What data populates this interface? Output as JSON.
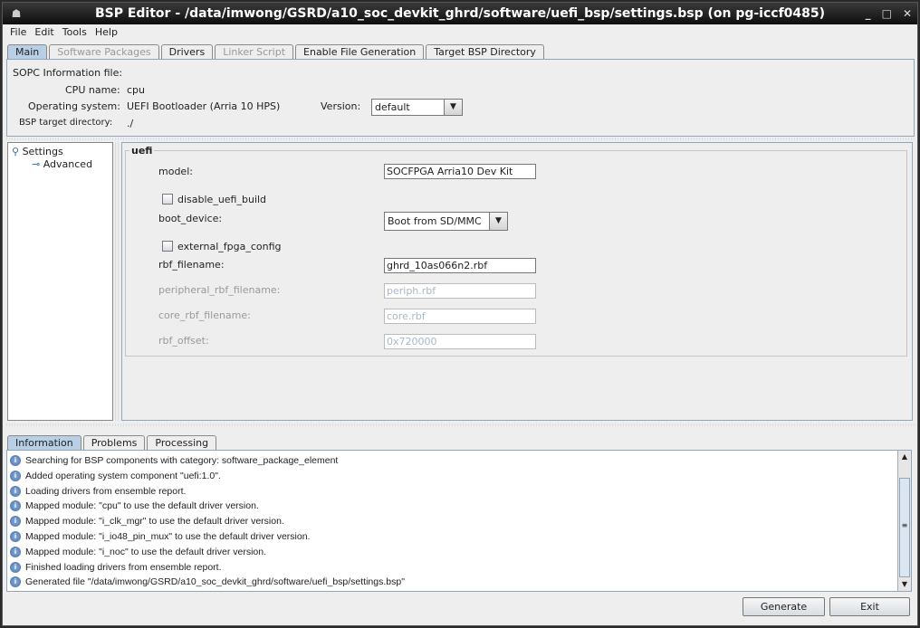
{
  "window": {
    "title": "BSP Editor - /data/imwong/GSRD/a10_soc_devkit_ghrd/software/uefi_bsp/settings.bsp (on pg-iccf0485)"
  },
  "menu": [
    "File",
    "Edit",
    "Tools",
    "Help"
  ],
  "tabs": [
    {
      "label": "Main"
    },
    {
      "label": "Software Packages"
    },
    {
      "label": "Drivers"
    },
    {
      "label": "Linker Script"
    },
    {
      "label": "Enable File Generation"
    },
    {
      "label": "Target BSP Directory"
    }
  ],
  "info": {
    "sopc_label": "SOPC Information file:",
    "cpu_label": "CPU name:",
    "cpu_value": "cpu",
    "os_label": "Operating system:",
    "os_value": "UEFI Bootloader (Arria 10 HPS)",
    "version_label": "Version:",
    "version_value": "default",
    "target_label": "BSP target directory:",
    "target_value": "./"
  },
  "tree": {
    "root": "Settings",
    "child": "Advanced"
  },
  "uefi": {
    "group": "uefi",
    "model_label": "model:",
    "model_value": "SOCFPGA Arria10 Dev Kit",
    "disable_label": "disable_uefi_build",
    "boot_label": "boot_device:",
    "boot_value": "Boot from SD/MMC",
    "extfpga_label": "external_fpga_config",
    "rbf_label": "rbf_filename:",
    "rbf_value": "ghrd_10as066n2.rbf",
    "periph_label": "peripheral_rbf_filename:",
    "periph_value": "periph.rbf",
    "core_label": "core_rbf_filename:",
    "core_value": "core.rbf",
    "offset_label": "rbf_offset:",
    "offset_value": "0x720000"
  },
  "bottom_tabs": [
    "Information",
    "Problems",
    "Processing"
  ],
  "log": [
    "Searching for BSP components with category: software_package_element",
    "Added operating system component \"uefi:1.0\".",
    "Loading drivers from ensemble report.",
    "Mapped module: \"cpu\" to use the default driver version.",
    "Mapped module: \"i_clk_mgr\" to use the default driver version.",
    "Mapped module: \"i_io48_pin_mux\" to use the default driver version.",
    "Mapped module: \"i_noc\" to use the default driver version.",
    "Finished loading drivers from ensemble report.",
    "Generated file \"/data/imwong/GSRD/a10_soc_devkit_ghrd/software/uefi_bsp/settings.bsp\""
  ],
  "buttons": {
    "generate": "Generate",
    "exit": "Exit"
  }
}
